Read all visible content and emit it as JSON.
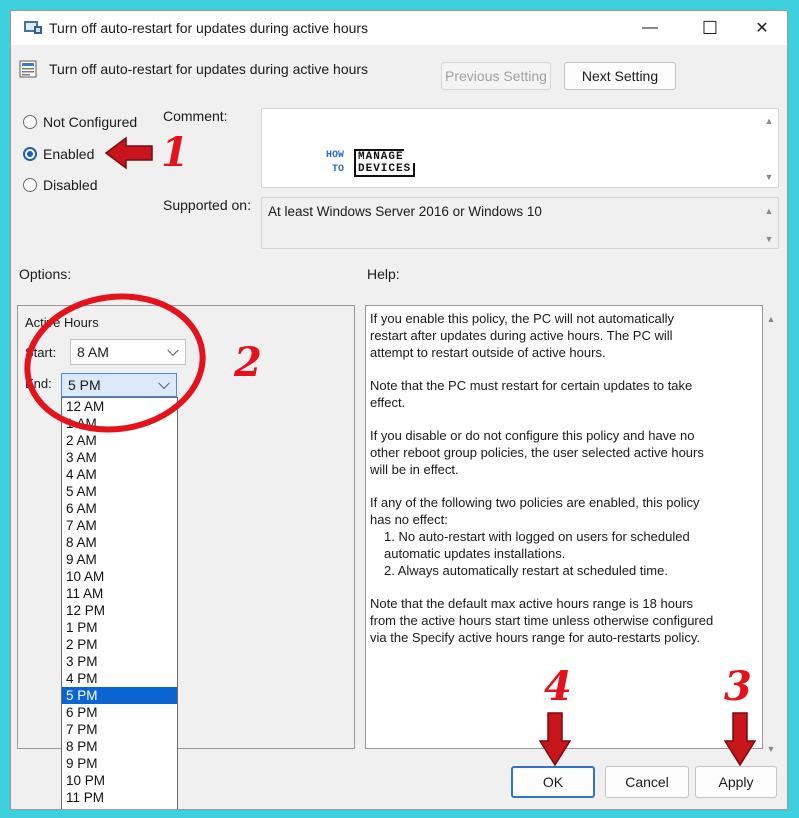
{
  "window": {
    "title": "Turn off auto-restart for updates during active hours",
    "controls": {
      "minimize": "—",
      "maximize": "☐",
      "close": "✕"
    }
  },
  "header": {
    "setting_name": "Turn off auto-restart for updates during active hours",
    "prev_button": "Previous Setting",
    "next_button": "Next Setting"
  },
  "state": {
    "options": [
      {
        "label": "Not Configured",
        "checked": false
      },
      {
        "label": "Enabled",
        "checked": true
      },
      {
        "label": "Disabled",
        "checked": false
      }
    ]
  },
  "comment": {
    "label": "Comment:",
    "logo": {
      "how": "HOW",
      "to": "TO",
      "manage": "MANAGE",
      "devices": "DEVICES"
    }
  },
  "supported": {
    "label": "Supported on:",
    "value": "At least Windows Server 2016 or Windows 10"
  },
  "options_section": {
    "label": "Options:",
    "group_label": "Active Hours",
    "start_label": "Start:",
    "start_value": "8 AM",
    "end_label": "End:",
    "end_value": "5 PM",
    "dropdown_items": [
      "12 AM",
      "1 AM",
      "2 AM",
      "3 AM",
      "4 AM",
      "5 AM",
      "6 AM",
      "7 AM",
      "8 AM",
      "9 AM",
      "10 AM",
      "11 AM",
      "12 PM",
      "1 PM",
      "2 PM",
      "3 PM",
      "4 PM",
      "5 PM",
      "6 PM",
      "7 PM",
      "8 PM",
      "9 PM",
      "10 PM",
      "11 PM"
    ],
    "selected_item": "5 PM"
  },
  "help_section": {
    "label": "Help:",
    "p1": "If you enable this policy, the PC will not automatically restart after updates during active hours. The PC will attempt to restart outside of active hours.",
    "p2": "Note that the PC must restart for certain updates to take effect.",
    "p3": "If you disable or do not configure this policy and have no other reboot group policies, the user selected active hours will be in effect.",
    "p4": "If any of the following two policies are enabled, this policy has no effect:",
    "p4_item1": "1. No auto-restart with logged on users for scheduled automatic updates installations.",
    "p4_item2": "2. Always automatically restart at scheduled time.",
    "p5": "Note that the default max active hours range is 18 hours from the active hours start time unless otherwise configured via the Specify active hours range for auto-restarts policy."
  },
  "footer": {
    "ok": "OK",
    "cancel": "Cancel",
    "apply": "Apply"
  },
  "annotations": {
    "one": "1",
    "two": "2",
    "three": "3",
    "four": "4",
    "color": "#e4121b"
  },
  "colors": {
    "background": "#3fd0de",
    "accent": "#0a64d2"
  }
}
